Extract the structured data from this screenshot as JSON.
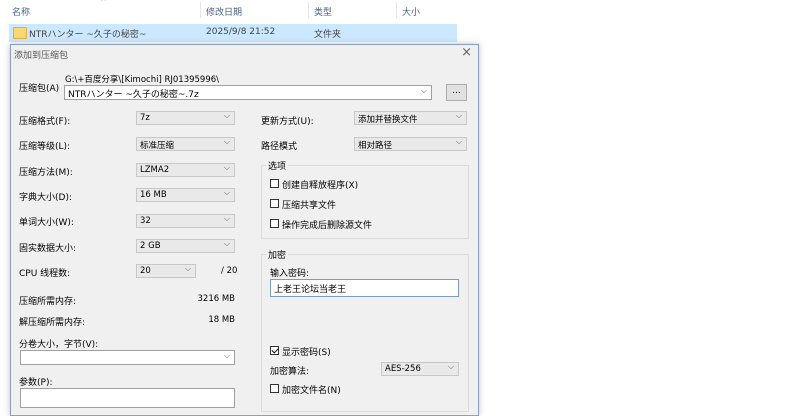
{
  "explorer": {
    "columns": {
      "name": "名称",
      "modified": "修改日期",
      "type": "类型",
      "size": "大小"
    },
    "file": {
      "name": "NTRハンター ~久子の秘密~",
      "modified": "2025/9/8 21:52",
      "type": "文件夹"
    }
  },
  "dialog": {
    "title": "添加到压缩包",
    "archive": {
      "label": "压缩包(A)",
      "path": "G:\\+百度分享\\[Kimochi] RJ01395996\\",
      "filename": "NTRハンター ~久子の秘密~.7z",
      "browse": "..."
    },
    "left": {
      "format": {
        "label": "压缩格式(F):",
        "value": "7z"
      },
      "level": {
        "label": "压缩等级(L):",
        "value": "标准压缩"
      },
      "method": {
        "label": "压缩方法(M):",
        "value": "LZMA2"
      },
      "dict": {
        "label": "字典大小(D):",
        "value": "16 MB"
      },
      "word": {
        "label": "单词大小(W):",
        "value": "32"
      },
      "solid": {
        "label": "固实数据大小:",
        "value": "2 GB"
      },
      "cpu": {
        "label": "CPU 线程数:",
        "value": "20",
        "max": "/ 20"
      },
      "mem_compress": {
        "label": "压缩所需内存:",
        "value": "3216 MB"
      },
      "mem_decompress": {
        "label": "解压缩所需内存:",
        "value": "18 MB"
      },
      "split": {
        "label": "分卷大小，字节(V):",
        "value": ""
      },
      "params": {
        "label": "参数(P):",
        "value": ""
      }
    },
    "right": {
      "update": {
        "label": "更新方式(U):",
        "value": "添加并替换文件"
      },
      "pathmode": {
        "label": "路径模式",
        "value": "相对路径"
      },
      "options": {
        "title": "选项",
        "sfx": {
          "label": "创建自释放程序(X)",
          "checked": false
        },
        "shared": {
          "label": "压缩共享文件",
          "checked": false
        },
        "delete": {
          "label": "操作完成后删除源文件",
          "checked": false
        }
      },
      "encryption": {
        "title": "加密",
        "password_label": "输入密码:",
        "password": "上老王论坛当老王",
        "show_password": {
          "label": "显示密码(S)",
          "checked": true
        },
        "method_label": "加密算法:",
        "method_value": "AES-256",
        "encrypt_names": {
          "label": "加密文件名(N)",
          "checked": false
        }
      }
    }
  },
  "colors": {
    "selection": "#cce8ff",
    "dialog_bg": "#f0f0f0",
    "header_text": "#4d6082"
  }
}
